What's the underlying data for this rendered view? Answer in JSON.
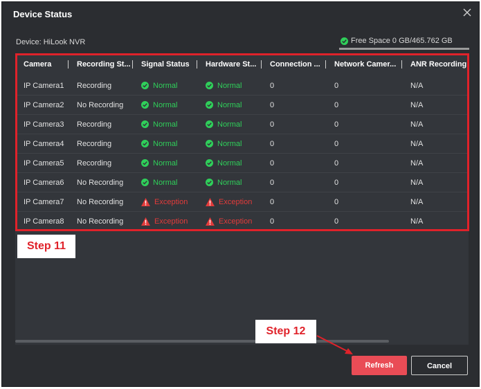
{
  "dialog": {
    "title": "Device Status",
    "device_label": "Device: HiLook NVR",
    "free_space": "Free Space 0 GB/465.762 GB"
  },
  "table": {
    "headers": [
      "Camera",
      "Recording St...",
      "Signal Status",
      "Hardware St...",
      "Connection ...",
      "Network Camer...",
      "ANR Recording"
    ],
    "rows": [
      {
        "camera": "IP Camera1",
        "recording": "Recording",
        "signal": "Normal",
        "hardware": "Normal",
        "connection": "0",
        "network": "0",
        "anr": "N/A"
      },
      {
        "camera": "IP Camera2",
        "recording": "No Recording",
        "signal": "Normal",
        "hardware": "Normal",
        "connection": "0",
        "network": "0",
        "anr": "N/A"
      },
      {
        "camera": "IP Camera3",
        "recording": "Recording",
        "signal": "Normal",
        "hardware": "Normal",
        "connection": "0",
        "network": "0",
        "anr": "N/A"
      },
      {
        "camera": "IP Camera4",
        "recording": "Recording",
        "signal": "Normal",
        "hardware": "Normal",
        "connection": "0",
        "network": "0",
        "anr": "N/A"
      },
      {
        "camera": "IP Camera5",
        "recording": "Recording",
        "signal": "Normal",
        "hardware": "Normal",
        "connection": "0",
        "network": "0",
        "anr": "N/A"
      },
      {
        "camera": "IP Camera6",
        "recording": "No Recording",
        "signal": "Normal",
        "hardware": "Normal",
        "connection": "0",
        "network": "0",
        "anr": "N/A"
      },
      {
        "camera": "IP Camera7",
        "recording": "No Recording",
        "signal": "Exception",
        "hardware": "Exception",
        "connection": "0",
        "network": "0",
        "anr": "N/A"
      },
      {
        "camera": "IP Camera8",
        "recording": "No Recording",
        "signal": "Exception",
        "hardware": "Exception",
        "connection": "0",
        "network": "0",
        "anr": "N/A"
      }
    ]
  },
  "callouts": {
    "step11": "Step 11",
    "step12": "Step 12"
  },
  "buttons": {
    "refresh": "Refresh",
    "cancel": "Cancel"
  },
  "colors": {
    "ok": "#2fcf5a",
    "error": "#e23b3b",
    "highlight": "#e0222a",
    "refresh_bg": "#e94c56"
  },
  "icons": {
    "normal": "check-circle-icon",
    "exception": "warning-triangle-icon",
    "close": "close-icon",
    "free_space": "check-circle-icon"
  }
}
